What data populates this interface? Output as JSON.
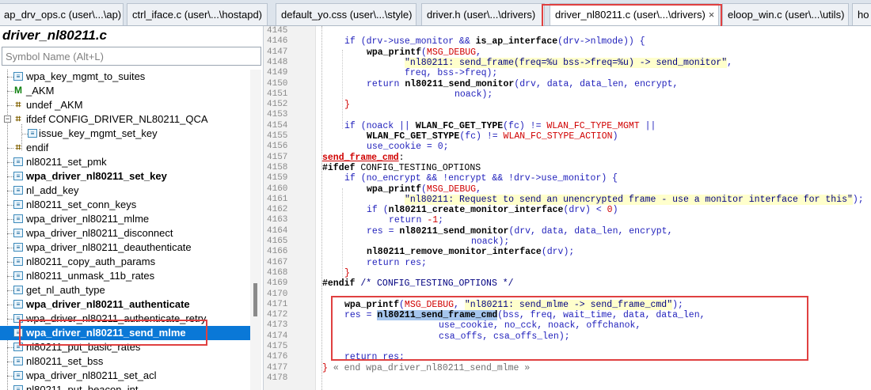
{
  "tabs": [
    {
      "label": "ap_drv_ops.c (user\\...\\ap)"
    },
    {
      "label": "ctrl_iface.c (user\\...\\hostapd)"
    },
    {
      "label": "default_yo.css (user\\...\\style)"
    },
    {
      "label": "driver.h (user\\...\\drivers)"
    },
    {
      "label": "driver_nl80211.c (user\\...\\drivers)",
      "close": "×"
    },
    {
      "label": "eloop_win.c (user\\...\\utils)"
    },
    {
      "label": "ho"
    }
  ],
  "panel": {
    "title": "driver_nl80211.c",
    "search_placeholder": "Symbol Name (Alt+L)"
  },
  "symbols": [
    {
      "label": "wpa_key_mgmt_to_suites",
      "icon": "function-icon"
    },
    {
      "label": "_AKM",
      "icon": "macro-icon"
    },
    {
      "label": "undef _AKM",
      "icon": "preprocessor-icon"
    },
    {
      "label": "ifdef CONFIG_DRIVER_NL80211_QCA",
      "icon": "preprocessor-icon"
    },
    {
      "label": "issue_key_mgmt_set_key",
      "icon": "function-icon"
    },
    {
      "label": "endif",
      "icon": "preprocessor-icon"
    },
    {
      "label": "nl80211_set_pmk",
      "icon": "function-icon"
    },
    {
      "label": "wpa_driver_nl80211_set_key",
      "icon": "function-icon"
    },
    {
      "label": "nl_add_key",
      "icon": "function-icon"
    },
    {
      "label": "nl80211_set_conn_keys",
      "icon": "function-icon"
    },
    {
      "label": "wpa_driver_nl80211_mlme",
      "icon": "function-icon"
    },
    {
      "label": "wpa_driver_nl80211_disconnect",
      "icon": "function-icon"
    },
    {
      "label": "wpa_driver_nl80211_deauthenticate",
      "icon": "function-icon"
    },
    {
      "label": "nl80211_copy_auth_params",
      "icon": "function-icon"
    },
    {
      "label": "nl80211_unmask_11b_rates",
      "icon": "function-icon"
    },
    {
      "label": "get_nl_auth_type",
      "icon": "function-icon"
    },
    {
      "label": "wpa_driver_nl80211_authenticate",
      "icon": "function-icon"
    },
    {
      "label": "wpa_driver_nl80211_authenticate_retry",
      "icon": "function-icon"
    },
    {
      "label": "wpa_driver_nl80211_send_mlme",
      "icon": "function-icon"
    },
    {
      "label": "nl80211_put_basic_rates",
      "icon": "function-icon"
    },
    {
      "label": "nl80211_set_bss",
      "icon": "function-icon"
    },
    {
      "label": "wpa_driver_nl80211_set_acl",
      "icon": "function-icon"
    },
    {
      "label": "nl80211_put_beacon_int",
      "icon": "function-icon"
    }
  ],
  "editor": {
    "line_numbers": [
      "4145",
      "4146",
      "4147",
      "4148",
      "4149",
      "4150",
      "4151",
      "4152",
      "4153",
      "4154",
      "4155",
      "4156",
      "4157",
      "4158",
      "4159",
      "4160",
      "4161",
      "4162",
      "4163",
      "4164",
      "4165",
      "4166",
      "4167",
      "4168",
      "4169",
      "4170",
      "4171",
      "4172",
      "4173",
      "4174",
      "4175",
      "4176",
      "4177",
      "4178"
    ],
    "lines": {
      "l4146": [
        "if (",
        "drv->use_monitor && ",
        "is_ap_interface",
        "(drv->nlmode)) {"
      ],
      "l4147": [
        "wpa_printf",
        "(",
        "MSG_DEBUG",
        ","
      ],
      "l4148": [
        "\"nl80211: send_frame(freq=%u bss->freq=%u) -> send_monitor\"",
        ","
      ],
      "l4149": [
        "freq, bss->freq);"
      ],
      "l4150": [
        "return ",
        "nl80211_send_monitor",
        "(drv, data, data_len, encrypt,"
      ],
      "l4151": [
        "noack);"
      ],
      "l4152": [
        "}"
      ],
      "l4154": [
        "if (",
        "noack || ",
        "WLAN_FC_GET_TYPE",
        "(fc) != ",
        "WLAN_FC_TYPE_MGMT",
        " ||"
      ],
      "l4155": [
        "WLAN_FC_GET_STYPE",
        "(fc) != ",
        "WLAN_FC_STYPE_ACTION",
        ")"
      ],
      "l4156": [
        "use_cookie = 0;"
      ],
      "l4157": [
        "send_frame_cmd",
        ":"
      ],
      "l4158": [
        "#ifdef ",
        "CONFIG_TESTING_OPTIONS"
      ],
      "l4159": [
        "if (",
        "no_encrypt && !encrypt && !drv->use_monitor) {"
      ],
      "l4160": [
        "wpa_printf",
        "(",
        "MSG_DEBUG",
        ","
      ],
      "l4161": [
        "\"nl80211: Request to send an unencrypted frame - use a monitor interface for this\"",
        ");"
      ],
      "l4162": [
        "if (",
        "nl80211_create_monitor_interface",
        "(drv) < ",
        "0",
        ")"
      ],
      "l4163": [
        "return ",
        "-1",
        ";"
      ],
      "l4164": [
        "res = ",
        "nl80211_send_monitor",
        "(drv, data, data_len, encrypt,"
      ],
      "l4165": [
        "noack);"
      ],
      "l4166": [
        "nl80211_remove_monitor_interface",
        "(drv);"
      ],
      "l4167": [
        "return ",
        "res;"
      ],
      "l4168": [
        "}"
      ],
      "l4169": [
        "#endif ",
        "/* CONFIG_TESTING_OPTIONS */"
      ],
      "l4171": [
        "wpa_printf",
        "(",
        "MSG_DEBUG",
        ", ",
        "\"nl80211: send_mlme -> send_frame_cmd\"",
        ");"
      ],
      "l4172": [
        "res = ",
        "nl80211_send_frame_cmd",
        "(bss, freq, wait_time, data, data_len,"
      ],
      "l4173": [
        "use_cookie, no_cck, noack, offchanok,"
      ],
      "l4174": [
        "csa_offs, csa_offs_len);"
      ],
      "l4176": [
        "return ",
        "res;"
      ],
      "l4177": [
        "}",
        " « end wpa_driver_nl80211_send_mlme »"
      ]
    }
  }
}
